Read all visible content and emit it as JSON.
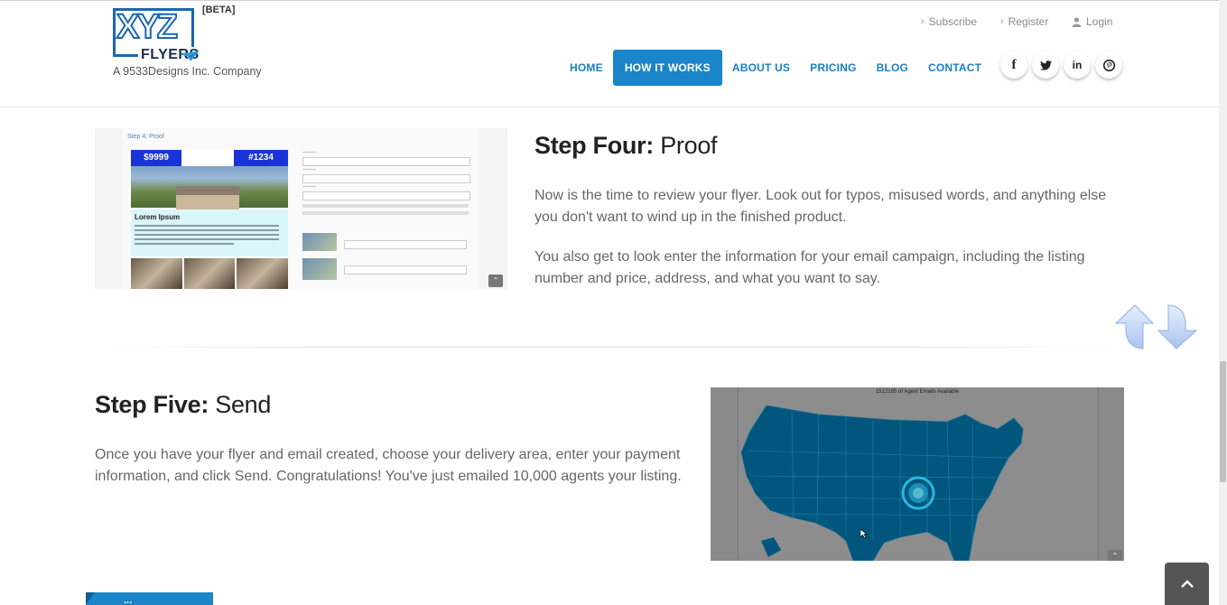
{
  "brand": {
    "logo_text": "XYZ",
    "logo_sub": "FLYERS",
    "beta": "[BETA]",
    "tagline": "A 9533Designs Inc. Company",
    "accent": "#1a85c8"
  },
  "util_links": {
    "subscribe": "Subscribe",
    "register": "Register",
    "login": "Login"
  },
  "nav": {
    "home": "HOME",
    "how_it_works": "HOW IT WORKS",
    "about_us": "ABOUT US",
    "pricing": "PRICING",
    "blog": "BLOG",
    "contact": "CONTACT",
    "active": "HOW IT WORKS"
  },
  "social": {
    "facebook": "f",
    "twitter": "twitter-icon",
    "linkedin": "in",
    "pinterest": "pinterest-icon"
  },
  "step_four": {
    "title_bold": "Step Four:",
    "title_rest": " Proof",
    "p1": "Now is the time to review your flyer. Look out for typos, misused words, and anything else you don't want to wind up in the finished product.",
    "p2": "You also get to look enter the information for your email campaign, including the listing number and price, address, and what you want to say.",
    "screenshot": {
      "crumb": "Step 4: Proof",
      "price": "$9999",
      "listing": "#1234",
      "heading": "Lorem Ipsum"
    }
  },
  "step_five": {
    "title_bold": "Step Five:",
    "title_rest": " Send",
    "p1": "Once you have your flyer and email created, choose your delivery area, enter your payment information, and click Send. Congratulations! You've just emailed 10,000 agents your listing.",
    "map_caption": "1512195 of Agent Emails Available"
  },
  "ribbon": {
    "label": "..."
  },
  "back_to_top": "chevron-up-icon"
}
